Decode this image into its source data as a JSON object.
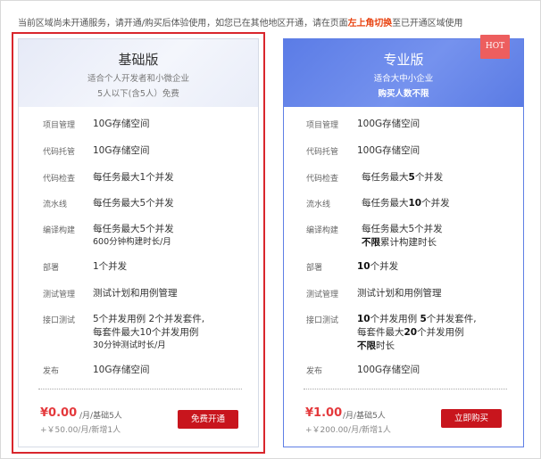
{
  "notice": {
    "text_before": "当前区域尚未开通服务，请开通/购买后体验使用，如您已在其他地区开通，请在页面",
    "highlight": "左上角切换",
    "text_after": "至已开通区域使用"
  },
  "plans": {
    "basic": {
      "title": "基础版",
      "subtitle1": "适合个人开发者和小微企业",
      "subtitle2": "5人以下(含5人）免费",
      "features": [
        {
          "label": "项目管理",
          "value": "10G存储空间"
        },
        {
          "label": "代码托管",
          "value": "10G存储空间"
        },
        {
          "label": "代码检查",
          "value": "每任务最大1个并发"
        },
        {
          "label": "流水线",
          "value": "每任务最大5个并发"
        },
        {
          "label": "编译构建",
          "value_line1": "每任务最大5个并发",
          "value_line2": "600分钟构建时长/月"
        },
        {
          "label": "部署",
          "value": "1个并发"
        },
        {
          "label": "测试管理",
          "value": "测试计划和用例管理"
        },
        {
          "label": "接口测试",
          "value_line1": "5个并发用例 2个并发套件,",
          "value_line2": "每套件最大10个并发用例",
          "value_line3": "30分钟测试时长/月"
        },
        {
          "label": "发布",
          "value": "10G存储空间"
        }
      ],
      "price": "¥0.00",
      "price_unit": "/月/基础5人",
      "price_extra": "+￥50.00/月/新增1人",
      "button": "免费开通"
    },
    "pro": {
      "badge": "HOT",
      "title": "专业版",
      "subtitle1": "适合大中小企业",
      "subtitle2": "购买人数不限",
      "features": [
        {
          "label": "项目管理",
          "value": "100G存储空间"
        },
        {
          "label": "代码托管",
          "value": "100G存储空间"
        },
        {
          "label": "代码检查",
          "pre": "每任务最大",
          "num": "5",
          "post": "个并发"
        },
        {
          "label": "流水线",
          "pre": "每任务最大",
          "num": "10",
          "post": "个并发"
        },
        {
          "label": "编译构建",
          "value_line1": "每任务最大5个并发",
          "bold2": "不限",
          "post2": "累计构建时长"
        },
        {
          "label": "部署",
          "num": "10",
          "post": "个并发"
        },
        {
          "label": "测试管理",
          "value": "测试计划和用例管理"
        },
        {
          "label": "接口测试",
          "num1": "10",
          "mid1": "个并发用例 ",
          "num2": "5",
          "post1": "个并发套件,",
          "pre2": "每套件最大",
          "num3": "20",
          "post2": "个并发用例",
          "bold3": "不限",
          "post3": "时长"
        },
        {
          "label": "发布",
          "value": "100G存储空间"
        }
      ],
      "price": "¥1.00",
      "price_unit": "/月/基础5人",
      "price_extra": "+￥200.00/月/新增1人",
      "button": "立即购买"
    }
  }
}
